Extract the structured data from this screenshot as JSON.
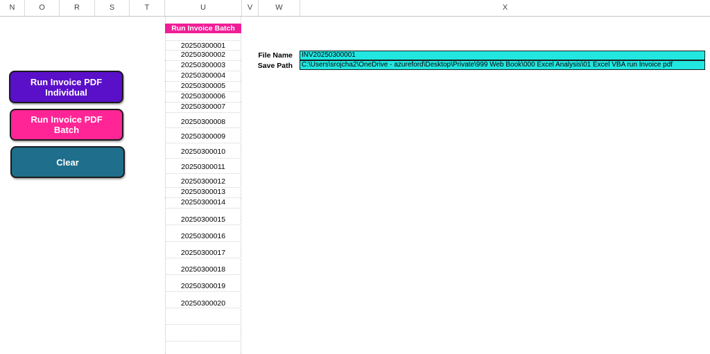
{
  "columns": [
    "N",
    "O",
    "R",
    "S",
    "T",
    "U",
    "V",
    "W",
    "X"
  ],
  "buttons": {
    "individual": "Run Invoice PDF\nIndividual",
    "batch": "Run Invoice PDF\nBatch",
    "clear": "Clear"
  },
  "batch": {
    "header": "Run Invoice Batch",
    "invoices": [
      "20250300001",
      "20250300002",
      "20250300003",
      "20250300004",
      "20250300005",
      "20250300006",
      "20250300007",
      "20250300008",
      "20250300009",
      "20250300010",
      "20250300011",
      "20250300012",
      "20250300013",
      "20250300014",
      "20250300015",
      "20250300016",
      "20250300017",
      "20250300018",
      "20250300019",
      "20250300020"
    ]
  },
  "file": {
    "name_label": "File Name",
    "name_value": "INV20250300001",
    "path_label": "Save Path",
    "path_value": "C:\\Users\\srojcha2\\OneDrive - azureford\\Desktop\\Private\\999 Web Book\\000 Excel Analysis\\01 Excel VBA run Invoice pdf"
  },
  "colors": {
    "individual_button": "#5a0fc8",
    "batch_button": "#ff2596",
    "clear_button": "#1f6e8c",
    "batch_header": "#f01e96",
    "value_fill": "#22e6e0"
  }
}
